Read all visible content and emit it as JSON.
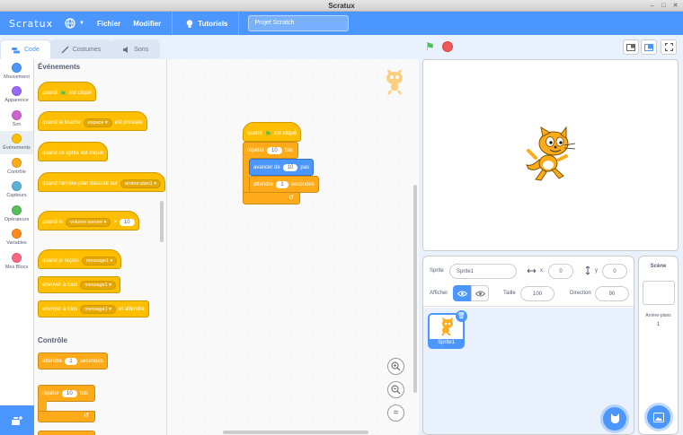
{
  "window": {
    "title": "Scratux"
  },
  "menubar": {
    "logo": "Scratux",
    "file": "Fichier",
    "edit": "Modifier",
    "tutorials": "Tutoriels",
    "project_title": "Projet Scratch"
  },
  "tabs": [
    {
      "label": "Code"
    },
    {
      "label": "Costumes"
    },
    {
      "label": "Sons"
    }
  ],
  "categories": [
    {
      "label": "Mouvement",
      "color": "#4c97ff"
    },
    {
      "label": "Apparence",
      "color": "#9966ff"
    },
    {
      "label": "Son",
      "color": "#cf63cf"
    },
    {
      "label": "Événements",
      "color": "#ffbf00"
    },
    {
      "label": "Contrôle",
      "color": "#ffab19"
    },
    {
      "label": "Capteurs",
      "color": "#5cb1d6"
    },
    {
      "label": "Opérateurs",
      "color": "#59c059"
    },
    {
      "label": "Variables",
      "color": "#ff8c1a"
    },
    {
      "label": "Mes Blocs",
      "color": "#ff6680"
    }
  ],
  "palette": {
    "events_title": "Événements",
    "control_title": "Contrôle",
    "b1_text": "quand",
    "b1_text2": "est cliqué",
    "b2_text": "quand la touche",
    "b2_key": "espace",
    "b2_text2": "est pressée",
    "b3_text": "quand ce sprite est cliqué",
    "b4_text": "quand l'arrière-plan bascule sur",
    "b4_drop": "arrière plan1",
    "b5_text": "quand le",
    "b5_drop": "volume sonore",
    "b5_op": ">",
    "b5_val": "10",
    "b6_text": "quand je reçois",
    "b6_drop": "message1",
    "b7_text": "envoyer à tous",
    "b7_drop": "message1",
    "b8_text": "envoyer à tous",
    "b8_drop": "message1",
    "b8_text2": "et attendre",
    "c1_text": "attendre",
    "c1_val": "1",
    "c1_text2": "secondes",
    "c2_text": "répéter",
    "c2_val": "10",
    "c2_text2": "fois"
  },
  "script": {
    "hat_text": "quand",
    "hat_text2": "est cliqué",
    "repeat_text": "répéter",
    "repeat_val": "10",
    "repeat_text2": "fois",
    "move_text": "avancer de",
    "move_val": "10",
    "move_text2": "pas",
    "wait_text": "attendre",
    "wait_val": "1",
    "wait_text2": "secondes"
  },
  "sprite_info": {
    "sprite_label": "Sprite",
    "sprite_name": "Sprite1",
    "x_label": "x",
    "x_value": "0",
    "y_label": "y",
    "y_value": "0",
    "show_label": "Afficher",
    "size_label": "Taille",
    "size_value": "100",
    "direction_label": "Direction",
    "direction_value": "90"
  },
  "sprites": [
    {
      "name": "Sprite1"
    }
  ],
  "scene": {
    "title": "Scène",
    "backdrops_label": "Arrière-plans",
    "backdrops_count": "1"
  }
}
